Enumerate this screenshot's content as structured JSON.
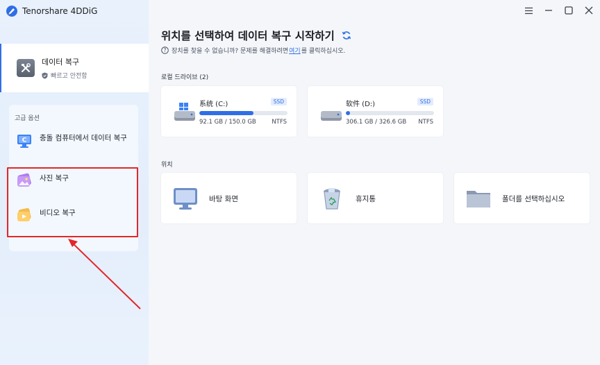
{
  "app": {
    "name": "Tenorshare 4DDiG"
  },
  "sidebar": {
    "main_item": {
      "title": "데이터 복구",
      "subtitle": "빠르고 안전함",
      "icon": "tools-icon"
    },
    "advanced": {
      "title": "고급 옵션",
      "items": [
        {
          "label": "충돌 컴퓨터에서 데이터 복구",
          "icon": "crashed-computer-icon"
        },
        {
          "label": "사진 복구",
          "icon": "photo-icon"
        },
        {
          "label": "비디오 복구",
          "icon": "video-icon"
        }
      ]
    }
  },
  "window_controls": [
    "menu-icon",
    "minimize-icon",
    "maximize-icon",
    "close-icon"
  ],
  "main": {
    "title": "위치를 선택하여 데이터 복구 시작하기",
    "help": {
      "prefix": "장치를 찾을 수 없습니까? 문제를 해결하려면",
      "link": "여기",
      "suffix": "를 클릭하십시오."
    },
    "drives_section": "로컬 드라이브 (2)",
    "drives": [
      {
        "name": "系统 (C:)",
        "badge": "SSD",
        "size": "92.1 GB / 150.0 GB",
        "fs": "NTFS",
        "used_fraction": 0.614
      },
      {
        "name": "软件 (D:)",
        "badge": "SSD",
        "size": "306.1 GB / 326.6 GB",
        "fs": "NTFS",
        "used_fraction": 0.05
      }
    ],
    "locations_section": "위치",
    "locations": [
      {
        "label": "바탕 화면",
        "icon": "desktop-icon"
      },
      {
        "label": "휴지통",
        "icon": "recycle-bin-icon"
      },
      {
        "label": "폴더를 선택하십시오",
        "icon": "folder-icon"
      }
    ]
  },
  "colors": {
    "accent": "#2f6fe6",
    "highlight": "#e3262b"
  }
}
